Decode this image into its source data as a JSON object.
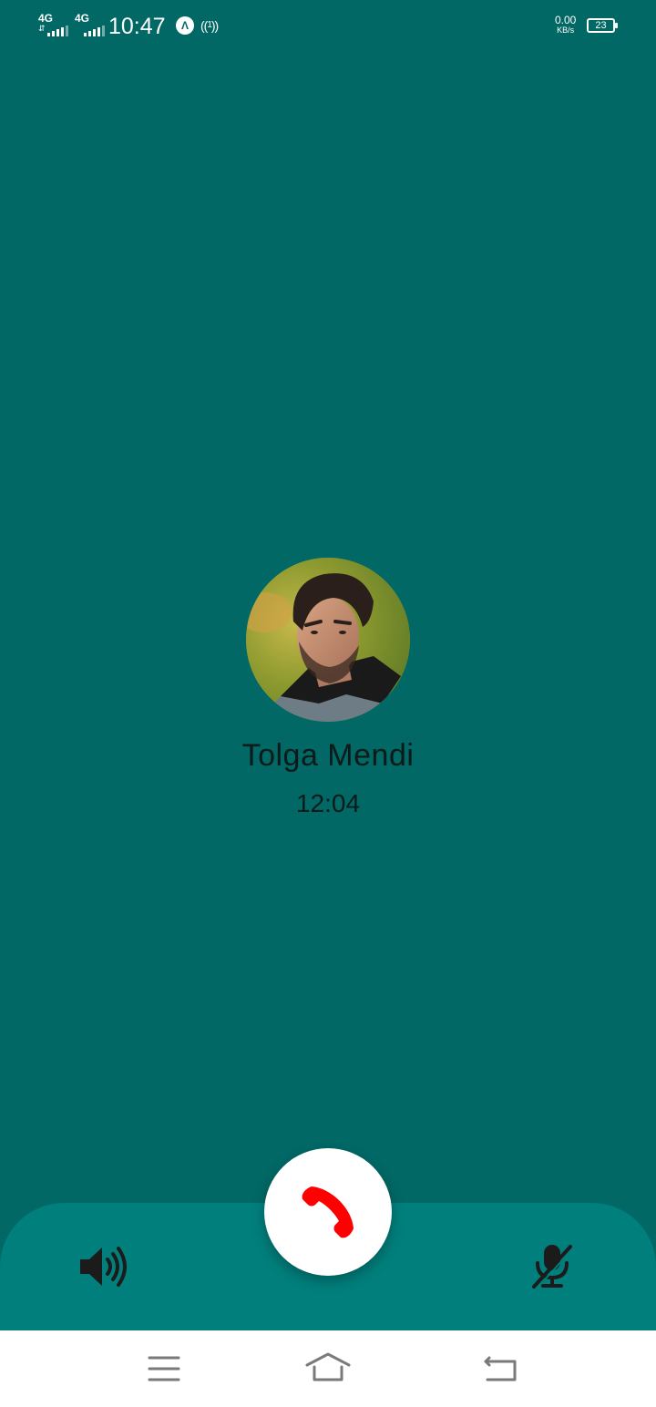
{
  "status_bar": {
    "network_1": "4G",
    "network_2": "4G",
    "time": "10:47",
    "app_notification_icon": "vpn-a-icon",
    "hotspot_icon": "hotspot-icon",
    "hotspot_count": "1",
    "net_speed_value": "0.00",
    "net_speed_unit": "KB/s",
    "battery_level": "23"
  },
  "call": {
    "caller_name": "Tolga Mendi",
    "duration": "12:04",
    "avatar_icon": "caller-avatar"
  },
  "controls": {
    "speaker_icon": "speaker-icon",
    "end_call_icon": "phone-hangup-icon",
    "mute_icon": "microphone-off-icon"
  },
  "nav_bar": {
    "menu_icon": "menu-icon",
    "home_icon": "home-icon",
    "back_icon": "back-icon"
  },
  "colors": {
    "background": "#016865",
    "panel": "#017f7c",
    "end_call_red": "#ff0000"
  }
}
